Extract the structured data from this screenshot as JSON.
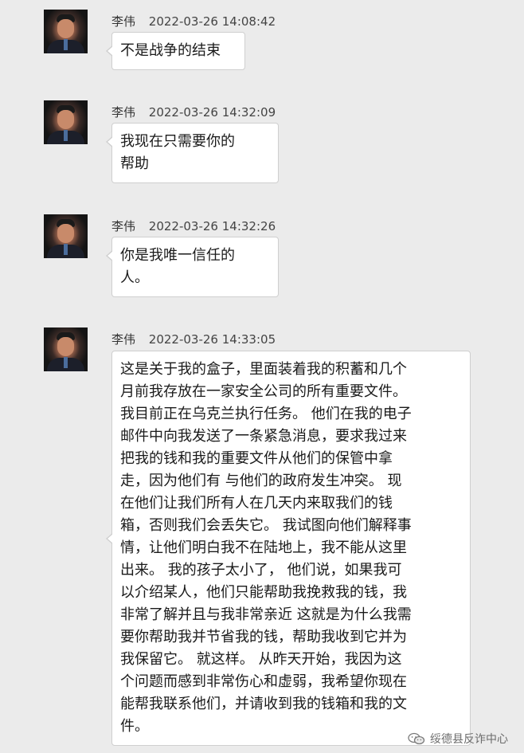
{
  "messages": [
    {
      "sender": "李伟",
      "time": "2022-03-26 14:08:42",
      "text": "不是战争的结束"
    },
    {
      "sender": "李伟",
      "time": "2022-03-26 14:32:09",
      "lines": [
        "我现在只需要你的",
        "帮助"
      ]
    },
    {
      "sender": "李伟",
      "time": "2022-03-26 14:32:26",
      "lines": [
        "你是我唯一信任的",
        "人。"
      ]
    },
    {
      "sender": "李伟",
      "time": "2022-03-26 14:33:05",
      "lines": [
        "这是关于我的盒子，里面装着我的积蓄和几个",
        "月前我存放在一家安全公司的所有重要文件。",
        "我目前正在乌克兰执行任务。 他们在我的电子",
        "邮件中向我发送了一条紧急消息，要求我过来",
        "把我的钱和我的重要文件从他们的保管中拿",
        "走，因为他们有 与他们的政府发生冲突。 现",
        "在他们让我们所有人在几天内来取我们的钱",
        "箱，否则我们会丢失它。 我试图向他们解释事",
        "情，让他们明白我不在陆地上，我不能从这里",
        "出来。 我的孩子太小了， 他们说，如果我可",
        "以介绍某人，他们只能帮助我挽救我的钱，我",
        "非常了解并且与我非常亲近 这就是为什么我需",
        "要你帮助我并节省我的钱，帮助我收到它并为",
        "我保留它。 就这样。 从昨天开始，我因为这",
        "个问题而感到非常伤心和虚弱，我希望你现在",
        "能帮我联系他们，并请收到我的钱箱和我的文",
        "件。"
      ]
    }
  ],
  "watermark": {
    "icon": "wechat-icon",
    "text": "绥德县反诈中心"
  }
}
